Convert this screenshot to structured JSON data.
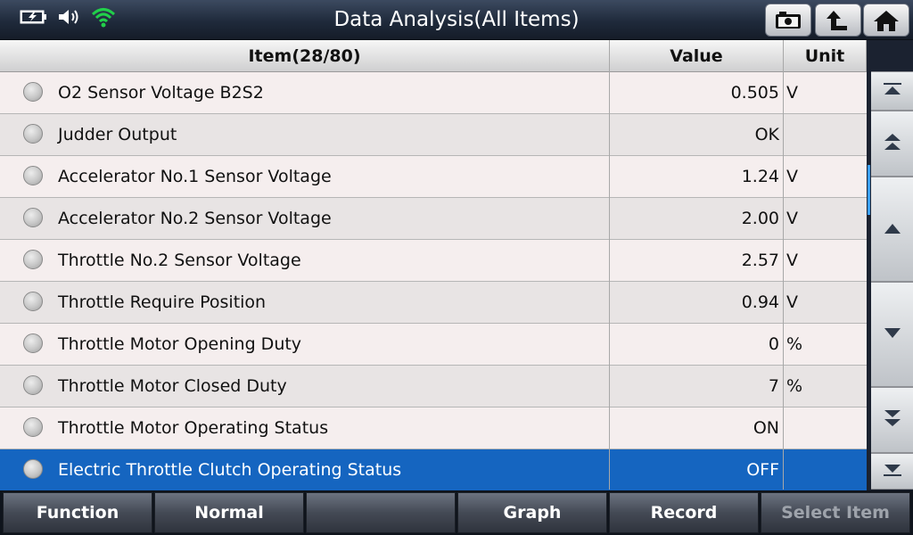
{
  "title": "Data Analysis(All Items)",
  "status": {
    "battery": "battery-charging-icon",
    "volume": "speaker-icon",
    "wifi": "wifi-icon"
  },
  "toolbar": {
    "screenshot": "camera-icon",
    "back": "back-arrow-icon",
    "home": "home-icon"
  },
  "table": {
    "headers": {
      "item": "Item(28/80)",
      "value": "Value",
      "unit": "Unit"
    },
    "rows": [
      {
        "name": "O2 Sensor Voltage B2S2",
        "value": "0.505",
        "unit": "V"
      },
      {
        "name": "Judder Output",
        "value": "OK",
        "unit": ""
      },
      {
        "name": "Accelerator No.1 Sensor Voltage",
        "value": "1.24",
        "unit": "V"
      },
      {
        "name": "Accelerator No.2 Sensor Voltage",
        "value": "2.00",
        "unit": "V"
      },
      {
        "name": "Throttle No.2 Sensor Voltage",
        "value": "2.57",
        "unit": "V"
      },
      {
        "name": "Throttle Require Position",
        "value": "0.94",
        "unit": "V"
      },
      {
        "name": "Throttle Motor Opening Duty",
        "value": "0",
        "unit": "%"
      },
      {
        "name": "Throttle Motor Closed Duty",
        "value": "7",
        "unit": "%"
      },
      {
        "name": "Throttle Motor Operating Status",
        "value": "ON",
        "unit": ""
      },
      {
        "name": "Electric Throttle Clutch Operating Status",
        "value": "OFF",
        "unit": ""
      }
    ],
    "selected_index": 9
  },
  "footer": {
    "function": "Function",
    "normal": "Normal",
    "blank": "",
    "graph": "Graph",
    "record": "Record",
    "select_item": "Select Item"
  },
  "colors": {
    "selected_row": "#1565c0",
    "wifi": "#21d04a",
    "scroll_indicator": "#3aa0ff"
  }
}
